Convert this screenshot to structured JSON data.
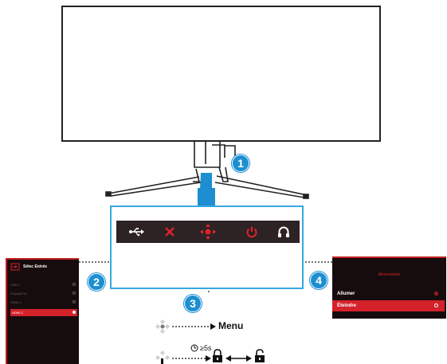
{
  "callouts": {
    "one": "1",
    "two": "2",
    "three": "3",
    "four": "4"
  },
  "key_icons": [
    "usb-icon",
    "close-icon",
    "navigation-joystick-icon",
    "power-icon",
    "headphone-icon"
  ],
  "osd_input": {
    "title": "Sélec Entrée",
    "items": [
      "USB-C",
      "DisplayPort",
      "HDMI-1",
      "HDMI-2"
    ],
    "selected_index": 3
  },
  "osd_power": {
    "title": "Alimentation",
    "items": [
      "Allumer",
      "Éteindre"
    ],
    "selected_index": 1,
    "checked_index": 0
  },
  "legend": {
    "menu_label": "Menu",
    "hold_label": "≥5s"
  },
  "colors": {
    "accent_blue": "#1d8fd1",
    "rog_red": "#d3222a",
    "osd_bg": "#160c0e"
  }
}
